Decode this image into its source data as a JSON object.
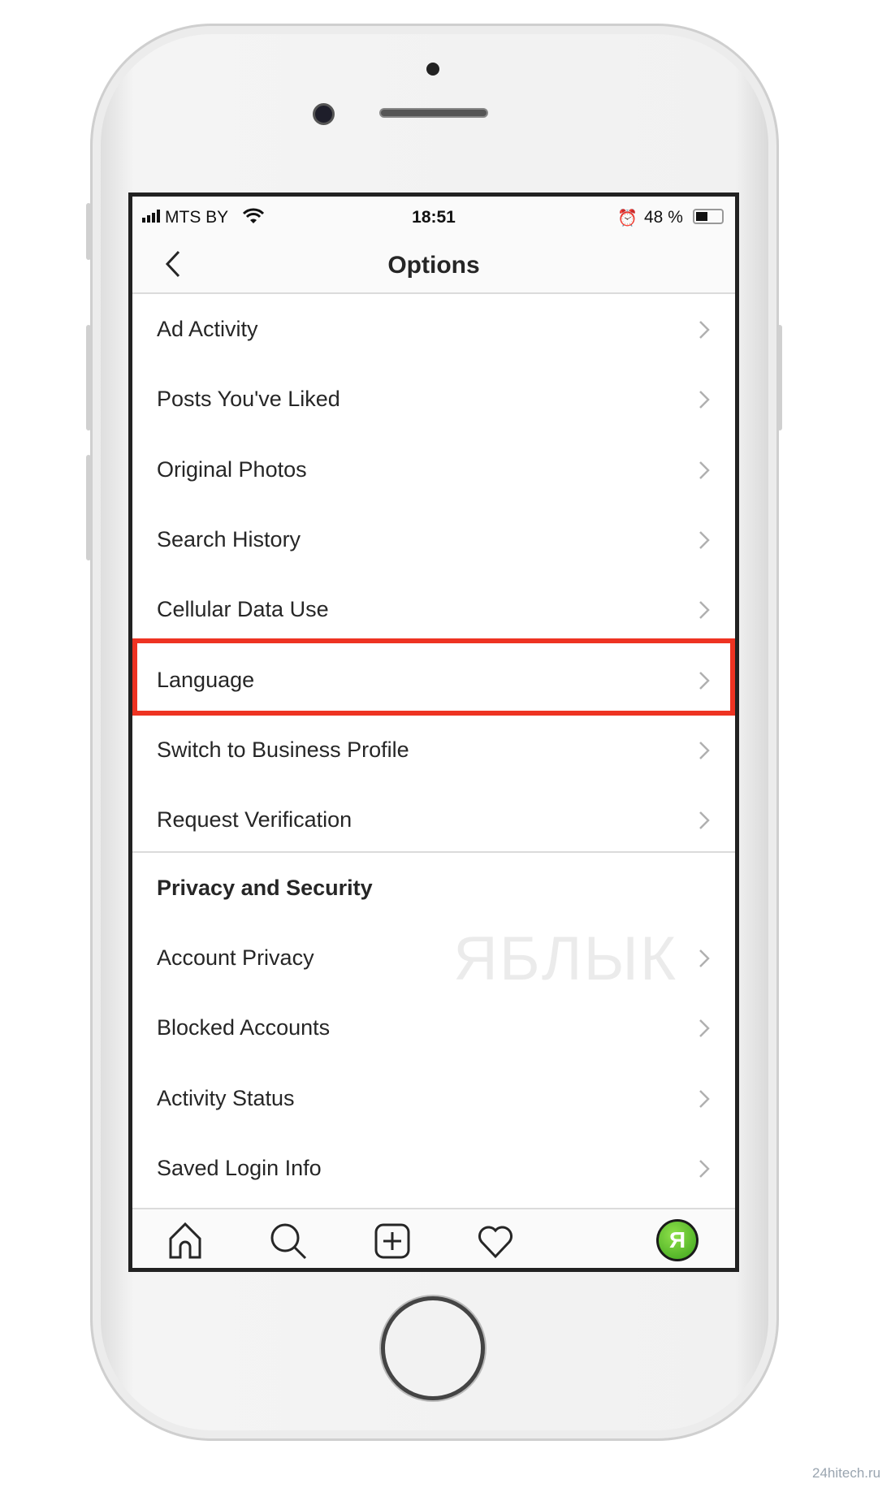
{
  "status_bar": {
    "carrier": "MTS BY",
    "time": "18:51",
    "battery": "48 %",
    "battery_level": 48,
    "icons": [
      "signal-icon",
      "wifi-icon",
      "alarm-icon",
      "battery-icon"
    ]
  },
  "header": {
    "title": "Options",
    "back_icon": "chevron-left-icon"
  },
  "rows": [
    {
      "label": "Ad Activity"
    },
    {
      "label": "Posts You've Liked"
    },
    {
      "label": "Original Photos"
    },
    {
      "label": "Search History"
    },
    {
      "label": "Cellular Data Use"
    },
    {
      "label": "Language",
      "highlighted": true
    },
    {
      "label": "Switch to Business Profile"
    },
    {
      "label": "Request Verification"
    }
  ],
  "privacy": {
    "title": "Privacy and Security",
    "rows": [
      {
        "label": "Account Privacy"
      },
      {
        "label": "Blocked Accounts"
      },
      {
        "label": "Activity Status"
      },
      {
        "label": "Saved Login Info"
      }
    ]
  },
  "tabbar": {
    "tabs": [
      "home-icon",
      "search-icon",
      "new-post-icon",
      "heart-icon",
      "profile-avatar"
    ],
    "avatar_letter": "Я"
  },
  "watermark": "ЯБЛЫК",
  "credit": "24hitech.ru",
  "colors": {
    "highlight": "#ee3322",
    "avatar": "#4cb625"
  }
}
